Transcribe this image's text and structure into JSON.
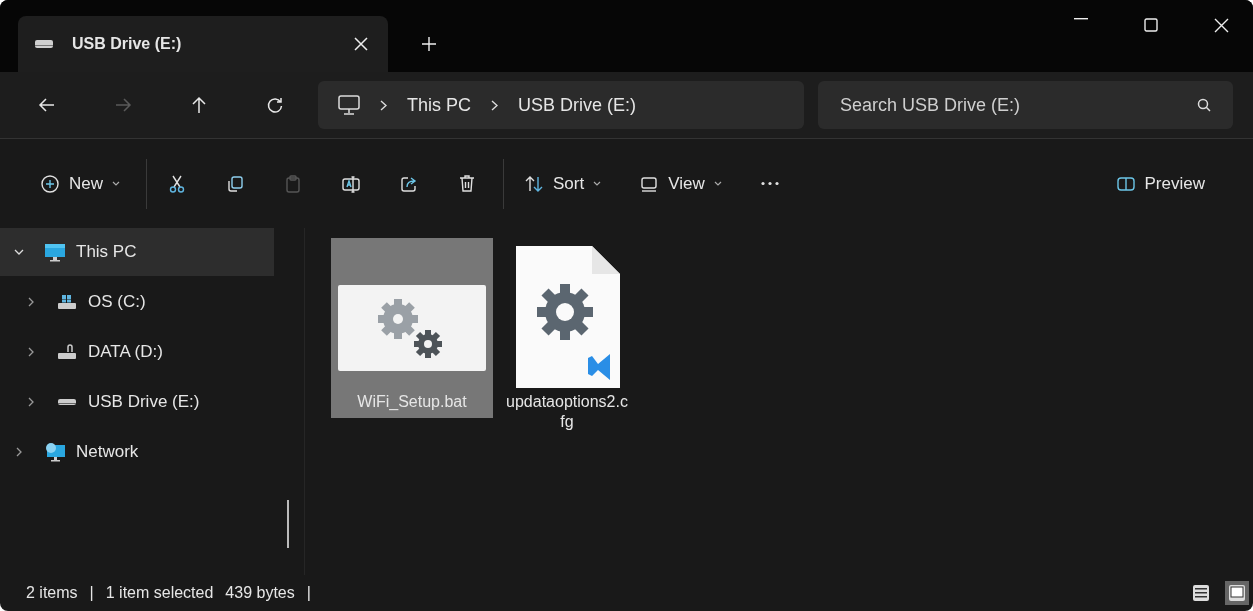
{
  "tab": {
    "title": "USB Drive (E:)"
  },
  "nav": {
    "buttons": [
      {
        "kind": "back",
        "disabled": false
      },
      {
        "kind": "forward",
        "disabled": true
      },
      {
        "kind": "up",
        "disabled": false
      },
      {
        "kind": "refresh",
        "disabled": false
      }
    ]
  },
  "address": {
    "crumbs": [
      "This PC",
      "USB Drive (E:)"
    ]
  },
  "search": {
    "placeholder": "Search USB Drive (E:)"
  },
  "toolbar": [
    {
      "kind": "new",
      "label": "New",
      "disabled": false
    },
    {
      "kind": "cut",
      "disabled": false
    },
    {
      "kind": "copy",
      "disabled": false
    },
    {
      "kind": "paste",
      "disabled": true
    },
    {
      "kind": "rename",
      "disabled": false
    },
    {
      "kind": "share",
      "disabled": false
    },
    {
      "kind": "delete",
      "disabled": false
    },
    {
      "kind": "sort",
      "label": "Sort",
      "disabled": false
    },
    {
      "kind": "view",
      "label": "View",
      "disabled": false
    },
    {
      "kind": "more",
      "disabled": false
    },
    {
      "kind": "preview",
      "label": "Preview",
      "disabled": false
    }
  ],
  "sidebar": {
    "items": [
      {
        "label": "This PC",
        "kind": "computer",
        "expanded": true,
        "selected": true,
        "children": [
          {
            "label": "OS (C:)",
            "kind": "system_drive",
            "expanded": false,
            "selected": false
          },
          {
            "label": "DATA (D:)",
            "kind": "drive",
            "expanded": false,
            "selected": false
          },
          {
            "label": "USB Drive (E:)",
            "kind": "removable",
            "expanded": false,
            "selected": false
          }
        ]
      },
      {
        "label": "Network",
        "kind": "network",
        "expanded": false,
        "selected": false
      }
    ]
  },
  "files": [
    {
      "name": "WiFi_Setup.bat",
      "kind": "batch",
      "selected": true
    },
    {
      "name": "updataoptions2.cfg",
      "kind": "config",
      "selected": false
    }
  ],
  "status_bar": {
    "texts": [
      "2 items",
      "|",
      "1 item selected",
      "439 bytes",
      "|"
    ],
    "views": [
      {
        "kind": "details",
        "selected": false
      },
      {
        "kind": "large_icons",
        "selected": true
      }
    ]
  }
}
